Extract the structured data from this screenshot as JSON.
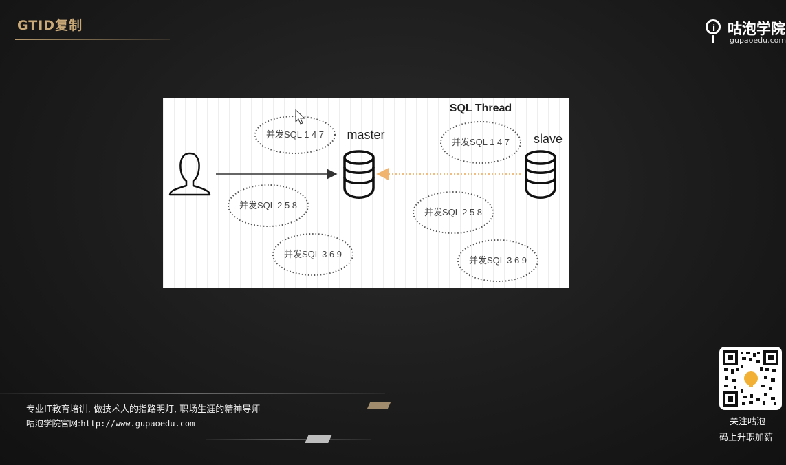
{
  "slide": {
    "title": "GTID复制"
  },
  "brand": {
    "name": "咕泡学院",
    "url": "gupaoedu.com",
    "icon": "lightbulb-logo-icon"
  },
  "diagram": {
    "heading": "SQL Thread",
    "master_label": "master",
    "slave_label": "slave",
    "master_bubbles": [
      "并发SQL 1  4 7",
      "并发SQL 2 5 8",
      "并发SQL 3 6 9"
    ],
    "slave_bubbles": [
      "并发SQL 1  4 7",
      "并发SQL 2 5 8",
      "并发SQL 3 6 9"
    ],
    "arrow_color": "#f0b46e",
    "icons": [
      "user-icon",
      "database-icon",
      "cursor-icon"
    ]
  },
  "footer": {
    "slogan": "专业IT教育培训, 做技术人的指路明灯, 职场生涯的精神导师",
    "website_label": "咕泡学院官网:",
    "website_url": "http://www.gupaoedu.com",
    "qr_caption_line1": "关注咕泡",
    "qr_caption_line2": "码上升职加薪"
  },
  "colors": {
    "title": "#c9a977",
    "background": "#1c1c1c"
  }
}
